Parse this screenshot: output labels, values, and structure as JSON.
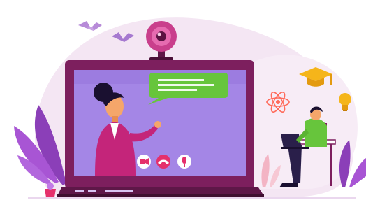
{
  "scene": {
    "alt": "",
    "controls": [
      {
        "name": "video-camera-button",
        "icon": "video-camera-icon",
        "color": "#e5306c"
      },
      {
        "name": "end-call-button",
        "icon": "phone-hangup-icon",
        "color": "#e5306c"
      },
      {
        "name": "microphone-button",
        "icon": "microphone-icon",
        "color": "#e5306c"
      }
    ],
    "decorations": [
      "bird-icon",
      "bird-icon",
      "bird-icon",
      "webcam-icon",
      "graduation-cap-icon",
      "atom-icon",
      "lightbulb-icon",
      "leaf-plant-icon"
    ]
  },
  "colors": {
    "laptop_body": "#7d1f5e",
    "screen": "#a486e6",
    "speech_bubble": "#67c53c",
    "accent_pink": "#e5306c",
    "background_blob": "#f4e6f3",
    "lightbulb": "#f5b51a"
  }
}
